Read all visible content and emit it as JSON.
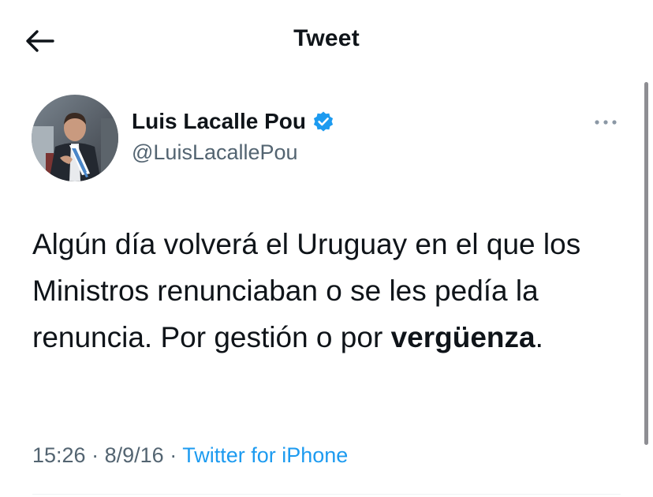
{
  "header": {
    "title": "Tweet",
    "back_icon": "arrow-left-icon"
  },
  "tweet": {
    "author": {
      "name": "Luis Lacalle Pou",
      "handle": "@LuisLacallePou",
      "verified": true,
      "verified_icon": "verified-badge-icon"
    },
    "text_before_bold": "Algún día volverá el Uruguay en el que los Ministros renunciaban o se les pedía la renuncia. Por gestión o por ",
    "text_bold": "vergüenza",
    "text_after_bold": ".",
    "time": "15:26",
    "separator_1": "·",
    "date": "8/9/16",
    "separator_2": "·",
    "source": "Twitter for iPhone"
  },
  "colors": {
    "text": "#0f1419",
    "secondary": "#536471",
    "link": "#1d9bf0",
    "verified": "#1d9bf0"
  }
}
